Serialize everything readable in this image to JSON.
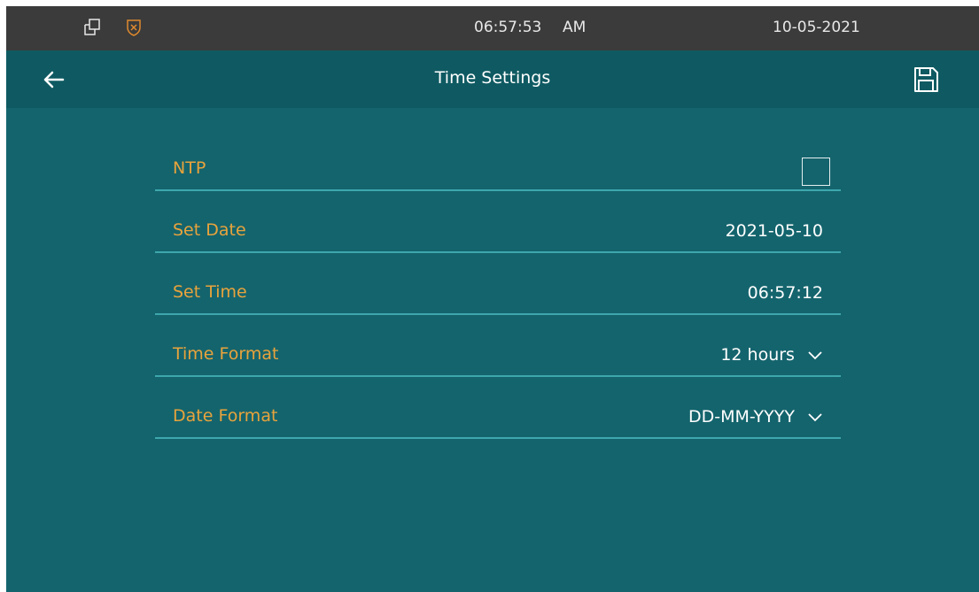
{
  "status_bar": {
    "time": "06:57:53",
    "ampm": "AM",
    "date": "10-05-2021",
    "icons": [
      "window-copy-icon",
      "shield-x-icon"
    ]
  },
  "header": {
    "title": "Time Settings",
    "back_icon": "arrow-left-icon",
    "save_icon": "floppy-disk-icon"
  },
  "settings": {
    "ntp": {
      "label": "NTP",
      "checked": false
    },
    "set_date": {
      "label": "Set Date",
      "value": "2021-05-10"
    },
    "set_time": {
      "label": "Set Time",
      "value": "06:57:12"
    },
    "time_format": {
      "label": "Time Format",
      "value": "12 hours"
    },
    "date_format": {
      "label": "Date Format",
      "value": "DD-MM-YYYY"
    }
  },
  "colors": {
    "background": "#14646d",
    "title_bar": "#0f5a62",
    "status_bar": "#3b3b3b",
    "label": "#e8a33c",
    "divider": "#3ea7ad",
    "shield": "#e08a2e"
  }
}
